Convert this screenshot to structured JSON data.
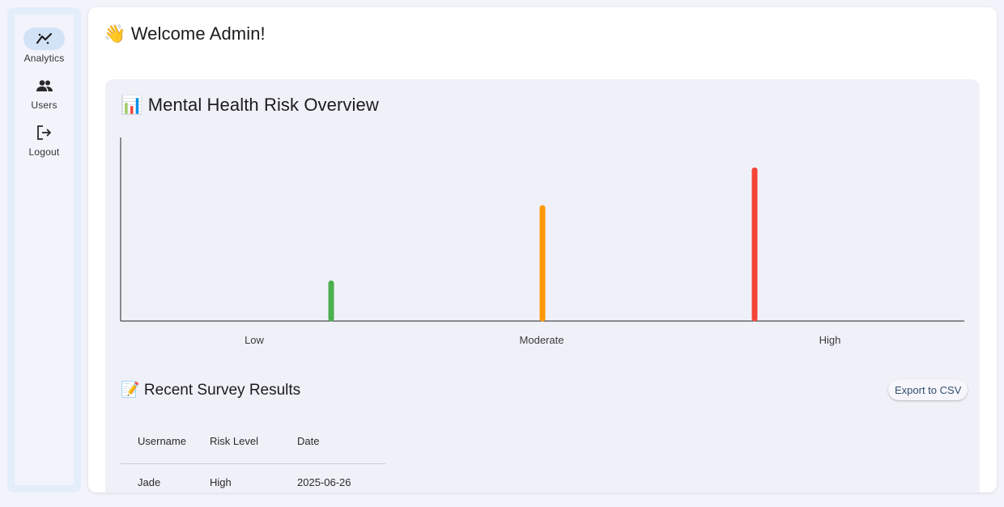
{
  "nav": {
    "items": [
      {
        "label": "Analytics",
        "icon": "analytics-icon",
        "active": true
      },
      {
        "label": "Users",
        "icon": "users-icon",
        "active": false
      },
      {
        "label": "Logout",
        "icon": "logout-icon",
        "active": false
      }
    ]
  },
  "header": {
    "welcome": "👋 Welcome Admin!"
  },
  "overview": {
    "title": "📊 Mental Health Risk Overview"
  },
  "chart_data": {
    "type": "bar",
    "title": "📊 Mental Health Risk Overview",
    "categories": [
      "Low",
      "Moderate",
      "High"
    ],
    "values": [
      1,
      3,
      4
    ],
    "colors": [
      "#4caf50",
      "#ff9800",
      "#f44336"
    ],
    "ylim": [
      0,
      5
    ],
    "grid": false,
    "legend": "none"
  },
  "survey": {
    "title": "📝 Recent Survey Results",
    "export_label": "Export to CSV",
    "columns": [
      "Username",
      "Risk Level",
      "Date"
    ],
    "rows": [
      [
        "Jade",
        "High",
        "2025-06-26"
      ]
    ]
  }
}
